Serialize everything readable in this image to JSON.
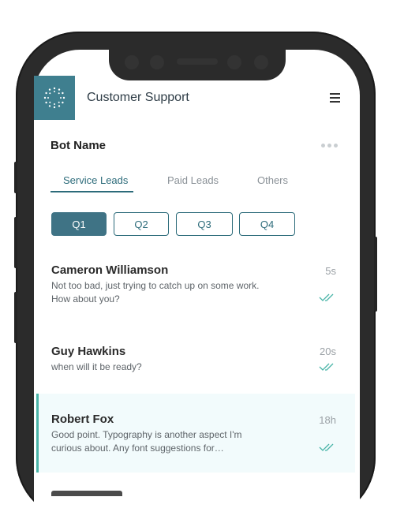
{
  "app": {
    "title": "Customer Support"
  },
  "bot": {
    "name": "Bot Name"
  },
  "tabs": [
    {
      "label": "Service Leads",
      "active": true
    },
    {
      "label": "Paid Leads",
      "active": false
    },
    {
      "label": "Others",
      "active": false
    }
  ],
  "quarters": [
    {
      "label": "Q1",
      "active": true
    },
    {
      "label": "Q2",
      "active": false
    },
    {
      "label": "Q3",
      "active": false
    },
    {
      "label": "Q4",
      "active": false
    }
  ],
  "conversations": [
    {
      "name": "Cameron Williamson",
      "message": "Not too bad, just trying to catch up on some work. How about you?",
      "time": "5s",
      "status_icon": "double-check-icon"
    },
    {
      "name": "Guy Hawkins",
      "message": "when will it be ready?",
      "time": "20s",
      "status_icon": "double-check-icon"
    },
    {
      "name": "Robert Fox",
      "message": "Good point. Typography is another aspect I'm curious about. Any font suggestions for…",
      "time": "18h",
      "status_icon": "double-check-icon",
      "highlighted": true
    }
  ],
  "colors": {
    "primary": "#3f7385",
    "accent": "#49b5a8",
    "highlight_bg": "#f2fbfc",
    "phone_frame": "#2b2b2b"
  }
}
